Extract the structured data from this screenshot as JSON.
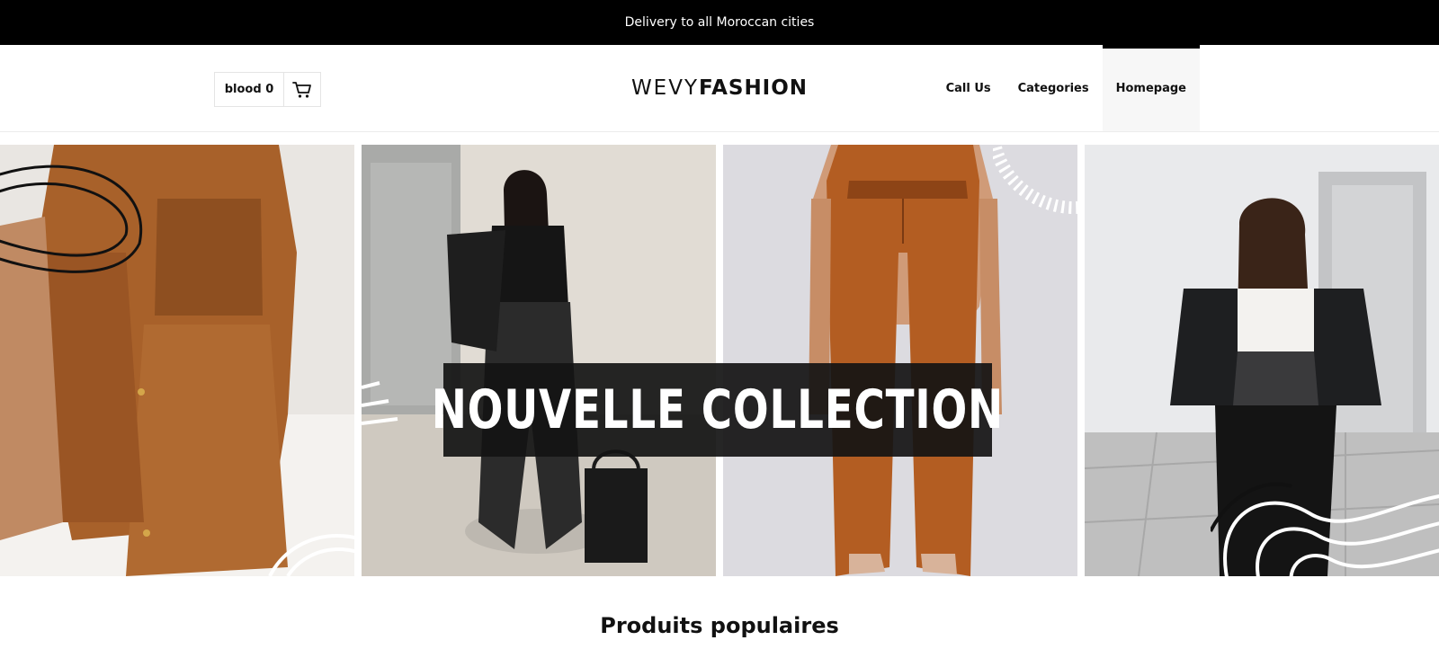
{
  "announcement": "Delivery to all Moroccan cities",
  "header": {
    "cart_label": "blood 0",
    "cart_icon": "cart-icon",
    "logo_light": "WEVY",
    "logo_bold": "FASHION",
    "nav": [
      "Call Us",
      "Categories",
      "Homepage"
    ],
    "nav_active": "Homepage"
  },
  "hero": {
    "banner_text": "NOUVELLE COLLECTION",
    "panels": [
      "tan leather jacket and shorts outfit",
      "woman in black leather pants",
      "brown leather wide-leg pants",
      "woman in black puffer jacket"
    ]
  },
  "section": {
    "title": "Produits populaires"
  },
  "colors": {
    "announcement_bg": "#000000",
    "banner_bg": "#141414",
    "leather_tan": "#a8612a",
    "accent_black": "#111111"
  }
}
